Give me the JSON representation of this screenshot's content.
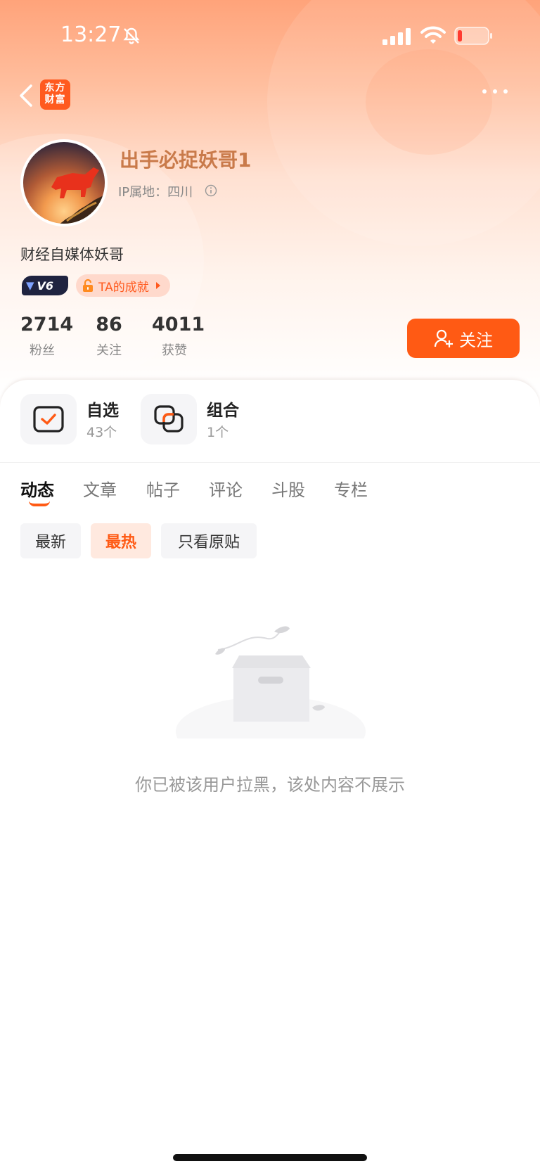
{
  "status_bar": {
    "time": "13:27",
    "icons": [
      "bell-muted-icon",
      "signal-icon",
      "wifi-icon",
      "battery-low-icon"
    ]
  },
  "nav": {
    "back_icon": "chevron-left-icon",
    "app_logo_line1": "东方",
    "app_logo_line2": "财富",
    "more_icon": "more-dots-icon"
  },
  "profile": {
    "username": "出手必捉妖哥1",
    "ip_location": "IP属地：四川",
    "bio": "财经自媒体妖哥",
    "level": "V6",
    "achievement_label": "TA的成就",
    "stats": [
      {
        "value": "2714",
        "label": "粉丝"
      },
      {
        "value": "86",
        "label": "关注"
      },
      {
        "value": "4011",
        "label": "获赞"
      }
    ],
    "follow_label": "关注"
  },
  "features": [
    {
      "title": "自选",
      "sub": "43个",
      "icon": "checkbox-icon"
    },
    {
      "title": "组合",
      "sub": "1个",
      "icon": "overlap-squares-icon"
    }
  ],
  "tabs": [
    "动态",
    "文章",
    "帖子",
    "评论",
    "斗股",
    "专栏"
  ],
  "active_tab": "动态",
  "filters": [
    "最新",
    "最热",
    "只看原贴"
  ],
  "active_filter": "最热",
  "empty_state": {
    "message": "你已被该用户拉黑，该处内容不展示",
    "icon": "empty-box-icon"
  },
  "colors": {
    "accent": "#ff5a14",
    "header_gradient_top": "#ffa37a",
    "username": "#c97a4a"
  }
}
